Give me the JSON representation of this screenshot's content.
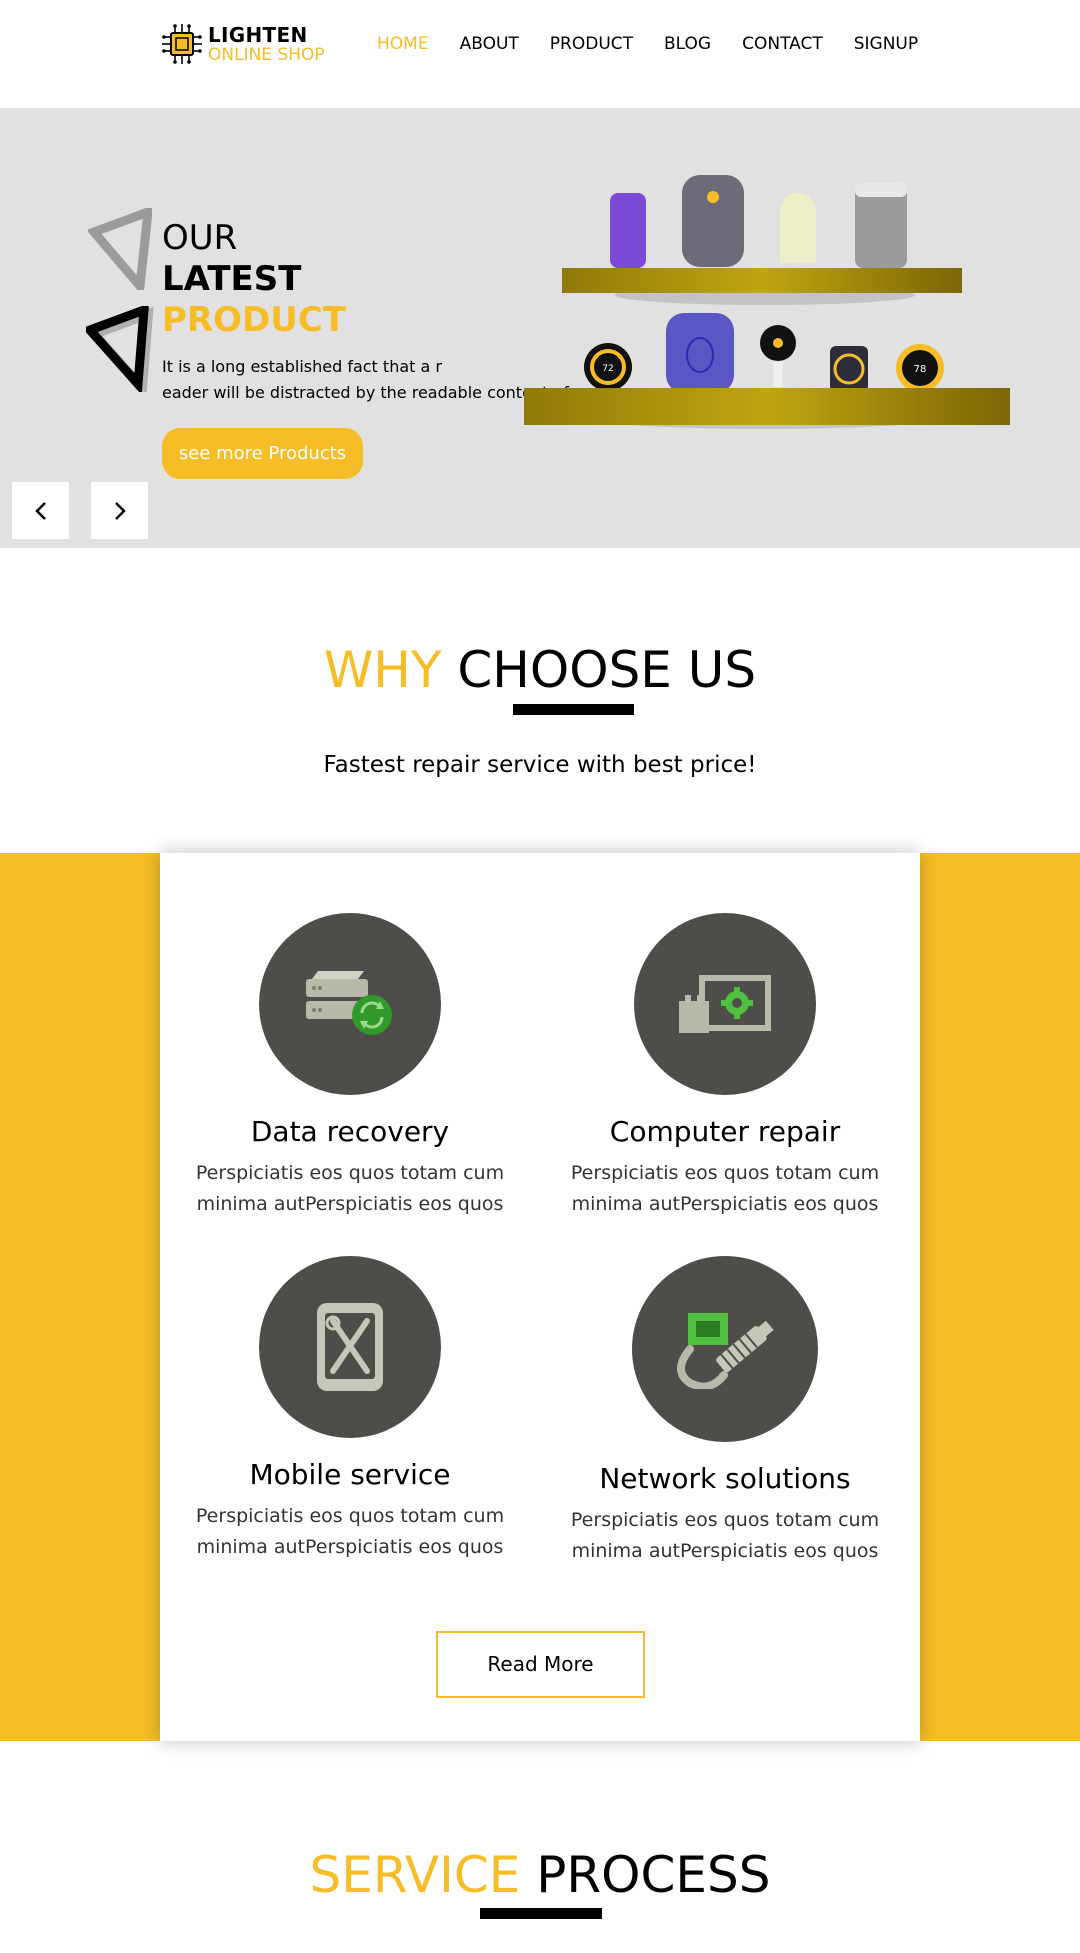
{
  "brand": {
    "name_line1": "LIGHTEN",
    "name_line2": "ONLINE SHOP",
    "accent": "#f6bd26"
  },
  "nav": {
    "items": [
      {
        "label": "HOME",
        "active": true
      },
      {
        "label": "ABOUT",
        "active": false
      },
      {
        "label": "PRODUCT",
        "active": false
      },
      {
        "label": "BLOG",
        "active": false
      },
      {
        "label": "CONTACT",
        "active": false
      },
      {
        "label": "SIGNUP",
        "active": false
      }
    ]
  },
  "hero": {
    "line1": "OUR",
    "line2": "LATEST",
    "line3": "PRODUCT",
    "text": "It is a long established fact that a r\neader will be distracted by the readable content of a page",
    "button_label": "see more Products",
    "prev_icon": "chevron-left-icon",
    "next_icon": "chevron-right-icon",
    "thermostat_left": "72",
    "thermostat_right": "78"
  },
  "why": {
    "title_a": "WHY",
    "title_b": "CHOOSE US",
    "subtitle": "Fastest repair service with best price!",
    "services": [
      {
        "title": "Data recovery",
        "desc": "Perspiciatis eos quos totam cum minima autPerspiciatis eos quos",
        "icon": "server-sync-icon"
      },
      {
        "title": "Computer repair",
        "desc": "Perspiciatis eos quos totam cum minima autPerspiciatis eos quos",
        "icon": "computer-gear-icon"
      },
      {
        "title": "Mobile service",
        "desc": "Perspiciatis eos quos totam cum minima autPerspiciatis eos quos",
        "icon": "phone-tools-icon"
      },
      {
        "title": "Network solutions",
        "desc": "Perspiciatis eos quos totam cum minima autPerspiciatis eos quos",
        "icon": "network-cable-icon"
      }
    ],
    "read_more": "Read More"
  },
  "process": {
    "title_a": "SERVICE",
    "title_b": "PROCESS"
  }
}
